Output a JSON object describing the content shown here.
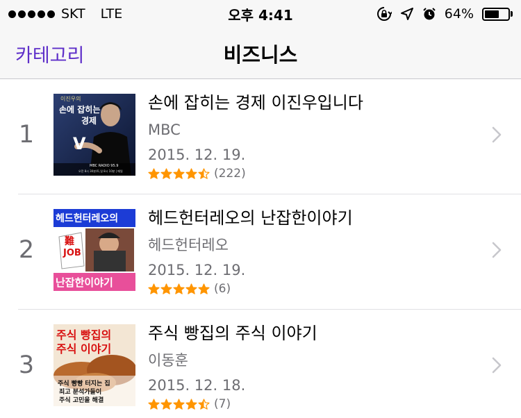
{
  "status_bar": {
    "carrier": "SKT",
    "network": "LTE",
    "time": "오후 4:41",
    "battery_percent": "64%",
    "battery_level": 0.64
  },
  "nav": {
    "back_label": "카테고리",
    "title": "비즈니스"
  },
  "accent_color": "#5e2fc9",
  "star_color": "#ff9500",
  "items": [
    {
      "rank": "1",
      "title": "손에 잡히는 경제 이진우입니다",
      "artist": "MBC",
      "date": "2015. 12. 19.",
      "rating": 4.5,
      "rating_count": "(222)",
      "artwork": {
        "line1": "이진우의",
        "line2": "손에 잡히는",
        "line3": "경제",
        "footer": "MBC RADIO 95.9",
        "footer2": "오전 8시 30분/토,일 8시 10분 | 매일"
      }
    },
    {
      "rank": "2",
      "title": "헤드헌터레오의 난잡한이야기",
      "artist": "헤드헌터레오",
      "date": "2015. 12. 19.",
      "rating": 5,
      "rating_count": "(6)",
      "artwork": {
        "top": "헤드헌터레오의",
        "mid1": "難",
        "mid2": "JOB",
        "bottom": "난잡한이야기"
      }
    },
    {
      "rank": "3",
      "title": "주식 빵집의 주식 이야기",
      "artist": "이동훈",
      "date": "2015. 12. 18.",
      "rating": 4.5,
      "rating_count": "(7)",
      "artwork": {
        "top1": "주식 빵집의",
        "top2": "주식 이야기",
        "b1": "주식 빵빵 터지는 집",
        "b2": "죄고 분석가들이",
        "b3": "주식 고민을 해결"
      }
    }
  ]
}
